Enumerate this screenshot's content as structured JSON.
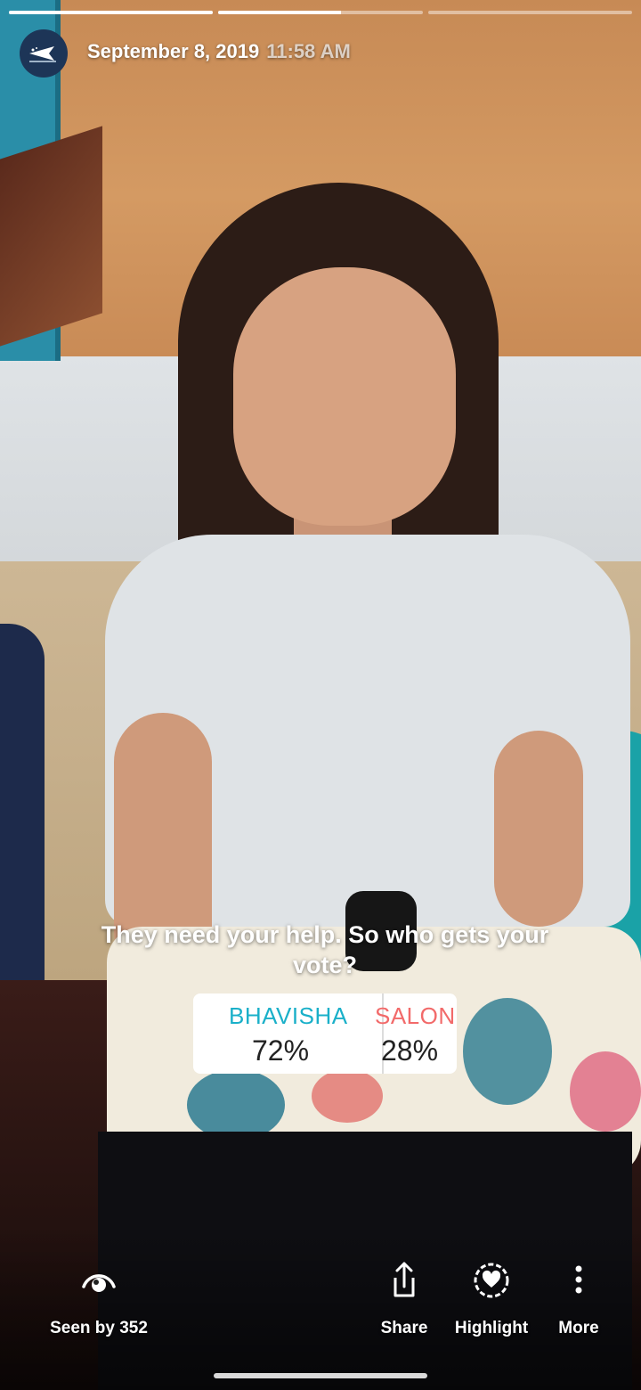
{
  "story": {
    "progress": [
      1.0,
      0.6,
      0.0
    ],
    "date": "September 8, 2019",
    "time": "11:58 AM"
  },
  "poll": {
    "question": "They need your help. So who gets your vote?",
    "options": [
      {
        "name": "BHAVISHA",
        "percent": "72%",
        "value": 72,
        "color": "#1ab0c9"
      },
      {
        "name": "SALONI",
        "percent": "28%",
        "value": 28,
        "color": "#f26a6a"
      }
    ]
  },
  "actions": {
    "seen": {
      "label": "Seen by 352",
      "icon": "eye-icon"
    },
    "share": {
      "label": "Share",
      "icon": "share-icon"
    },
    "highlight": {
      "label": "Highlight",
      "icon": "heart-circle-icon"
    },
    "more": {
      "label": "More",
      "icon": "more-vertical-icon"
    }
  }
}
